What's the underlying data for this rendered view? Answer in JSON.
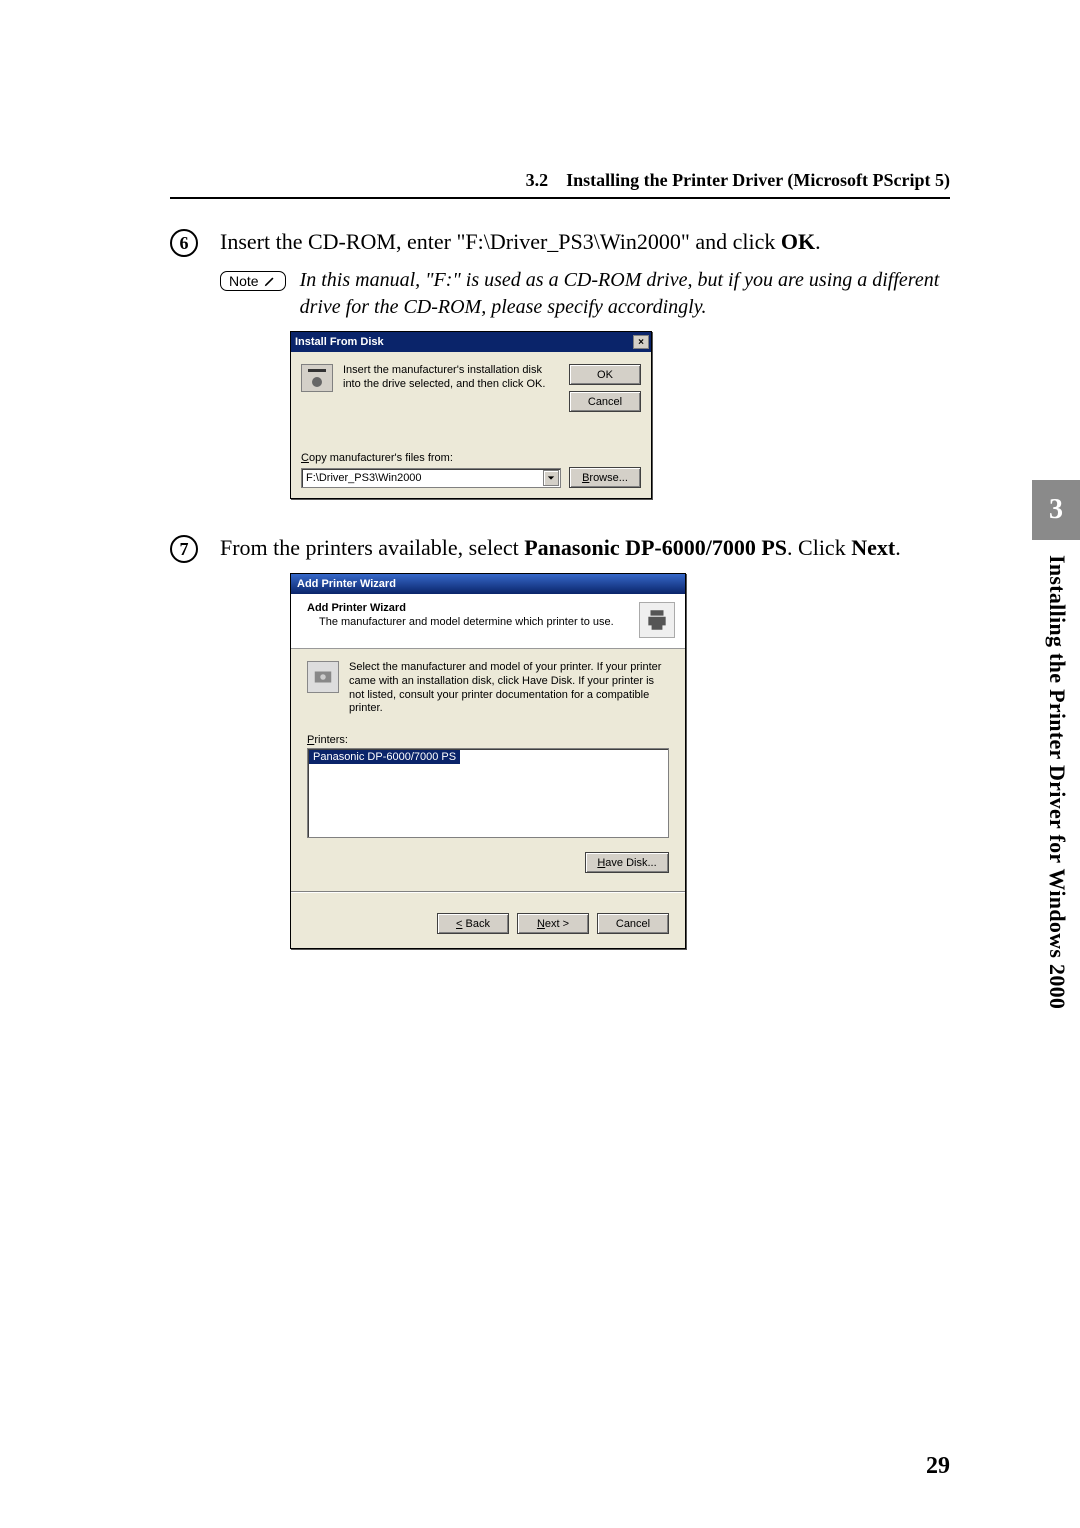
{
  "header": {
    "section_number": "3.2",
    "section_title": "Installing the Printer Driver (Microsoft PScript 5)"
  },
  "step6": {
    "marker": "6",
    "text_before": "Insert the CD-ROM, enter \"F:\\Driver_PS3\\Win2000\" and click ",
    "text_bold": "OK",
    "text_after": "."
  },
  "note": {
    "label": "Note",
    "text": "In this manual, \"F:\" is used as a CD-ROM drive, but if you are using a different drive for the CD-ROM, please specify accordingly."
  },
  "dialog1": {
    "title": "Install From Disk",
    "close_glyph": "×",
    "message": "Insert the manufacturer's installation disk into the drive selected, and then click OK.",
    "ok_label": "OK",
    "cancel_label": "Cancel",
    "copy_label": "Copy manufacturer's files from:",
    "path_value": "F:\\Driver_PS3\\Win2000",
    "browse_label": "Browse..."
  },
  "step7": {
    "marker": "7",
    "text_before": "From the printers available, select ",
    "text_bold1": "Panasonic DP-6000/7000 PS",
    "text_mid": ". Click ",
    "text_bold2": "Next",
    "text_after": "."
  },
  "dialog2": {
    "title": "Add Printer Wizard",
    "header_title": "Add Printer Wizard",
    "header_sub": "The manufacturer and model determine which printer to use.",
    "info_text": "Select the manufacturer and model of your printer. If your printer came with an installation disk, click Have Disk. If your printer is not listed, consult your printer documentation for a compatible printer.",
    "list_label": "Printers:",
    "selected_item": "Panasonic DP-6000/7000 PS",
    "have_disk_label": "Have Disk...",
    "back_label": "Back",
    "next_label": "Next",
    "cancel_label": "Cancel"
  },
  "side": {
    "chapter_number": "3",
    "chapter_title": "Installing the Printer Driver for Windows 2000"
  },
  "page_number": "29"
}
